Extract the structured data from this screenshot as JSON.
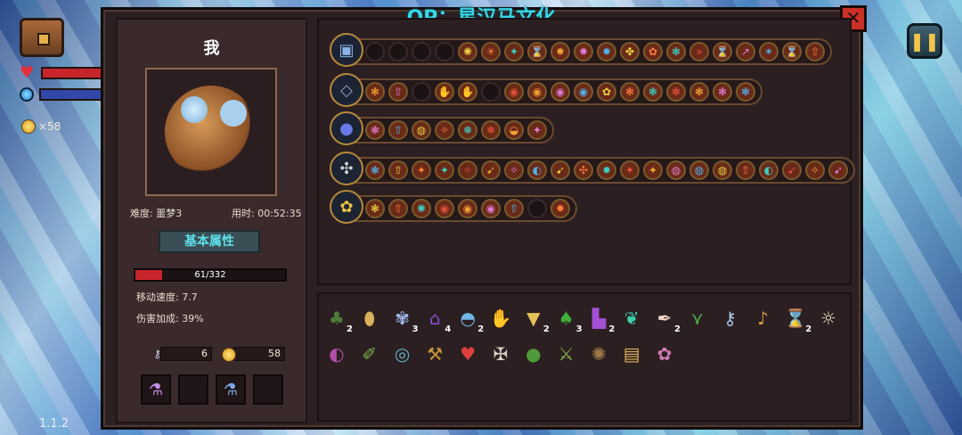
{
  "title": "OP：星汉马文化",
  "version": "1.1.2",
  "hud": {
    "coins": "×58"
  },
  "player": {
    "name": "我",
    "difficulty": "难度: 噩梦3",
    "time": "用时: 00:52:35",
    "attr_button": "基本属性",
    "hp_text": "61/332",
    "hp_fraction": 0.18,
    "move_speed": "移动速度: 7.7",
    "damage_bonus": "伤害加成: 39%",
    "keys": "6",
    "gold": "58"
  },
  "slots": [
    "⚗",
    "",
    "⚗",
    ""
  ],
  "skill_rows": [
    {
      "head": "▣",
      "runes": [
        "",
        "",
        "",
        "",
        "✺",
        "☀",
        "✦",
        "⌛",
        "✹",
        "✹",
        "✹",
        "✤",
        "✿",
        "❃",
        "»",
        "⌛",
        "↗",
        "✶",
        "⌛",
        "⇧"
      ],
      "muted": 4
    },
    {
      "head": "◇",
      "runes": [
        "❃",
        "⇧",
        "",
        "✋",
        "✋",
        "",
        "◉",
        "◉",
        "◉",
        "◉",
        "✿",
        "❃",
        "❃",
        "❃",
        "❃",
        "❃",
        "❃"
      ],
      "muted": 0
    },
    {
      "head": "●",
      "runes": [
        "❃",
        "⇧",
        "◍",
        "✧",
        "❅",
        "❅",
        "◒",
        "✦"
      ],
      "muted": 0
    },
    {
      "head": "✣",
      "runes": [
        "❃",
        "⇧",
        "✦",
        "✦",
        "✧",
        "➹",
        "✧",
        "◐",
        "➹",
        "✣",
        "✹",
        "✦",
        "✦",
        "◍",
        "◍",
        "◍",
        "⇧",
        "◐",
        "➹",
        "✧",
        "➹"
      ],
      "muted": 0
    },
    {
      "head": "✿",
      "runes": [
        "❃",
        "⇧",
        "✺",
        "◉",
        "◉",
        "◉",
        "⇧",
        "",
        "✹"
      ],
      "muted": 0
    }
  ],
  "items": [
    {
      "g": "♣",
      "c": "2",
      "col": "#4f7a3a"
    },
    {
      "g": "⬮",
      "c": "",
      "col": "#d8b25a"
    },
    {
      "g": "✾",
      "c": "3",
      "col": "#9fb7e8"
    },
    {
      "g": "⌂",
      "c": "4",
      "col": "#8a4fd6"
    },
    {
      "g": "◓",
      "c": "2",
      "col": "#6fb7e6"
    },
    {
      "g": "✋",
      "c": "",
      "col": "#4a6fb0"
    },
    {
      "g": "▼",
      "c": "2",
      "col": "#e6c35a"
    },
    {
      "g": "♠",
      "c": "3",
      "col": "#3fae3a"
    },
    {
      "g": "▙",
      "c": "2",
      "col": "#a24fd6"
    },
    {
      "g": "❦",
      "c": "",
      "col": "#3fd0a8"
    },
    {
      "g": "✒",
      "c": "2",
      "col": "#f0d9c8"
    },
    {
      "g": "⋎",
      "c": "",
      "col": "#49b04a"
    },
    {
      "g": "⚷",
      "c": "",
      "col": "#a8c8ea"
    },
    {
      "g": "♪",
      "c": "",
      "col": "#d69a4a"
    },
    {
      "g": "⌛",
      "c": "2",
      "col": "#e0b24a"
    },
    {
      "g": "☼",
      "c": "",
      "col": "#e8e0c0"
    },
    {
      "g": "◐",
      "c": "",
      "col": "#b04fa8"
    },
    {
      "g": "✐",
      "c": "",
      "col": "#7ab04a"
    },
    {
      "g": "◎",
      "c": "",
      "col": "#5fb0c8"
    },
    {
      "g": "⚒",
      "c": "",
      "col": "#c8963a"
    },
    {
      "g": "♥",
      "c": "",
      "col": "#e0403a"
    },
    {
      "g": "✠",
      "c": "",
      "col": "#d8d0c0"
    },
    {
      "g": "●",
      "c": "",
      "col": "#4f9a3a"
    },
    {
      "g": "⚔",
      "c": "",
      "col": "#8ab04a"
    },
    {
      "g": "✺",
      "c": "",
      "col": "#a27a4a"
    },
    {
      "g": "▤",
      "c": "",
      "col": "#e0b05a"
    },
    {
      "g": "✿",
      "c": "",
      "col": "#d07ab0"
    }
  ]
}
